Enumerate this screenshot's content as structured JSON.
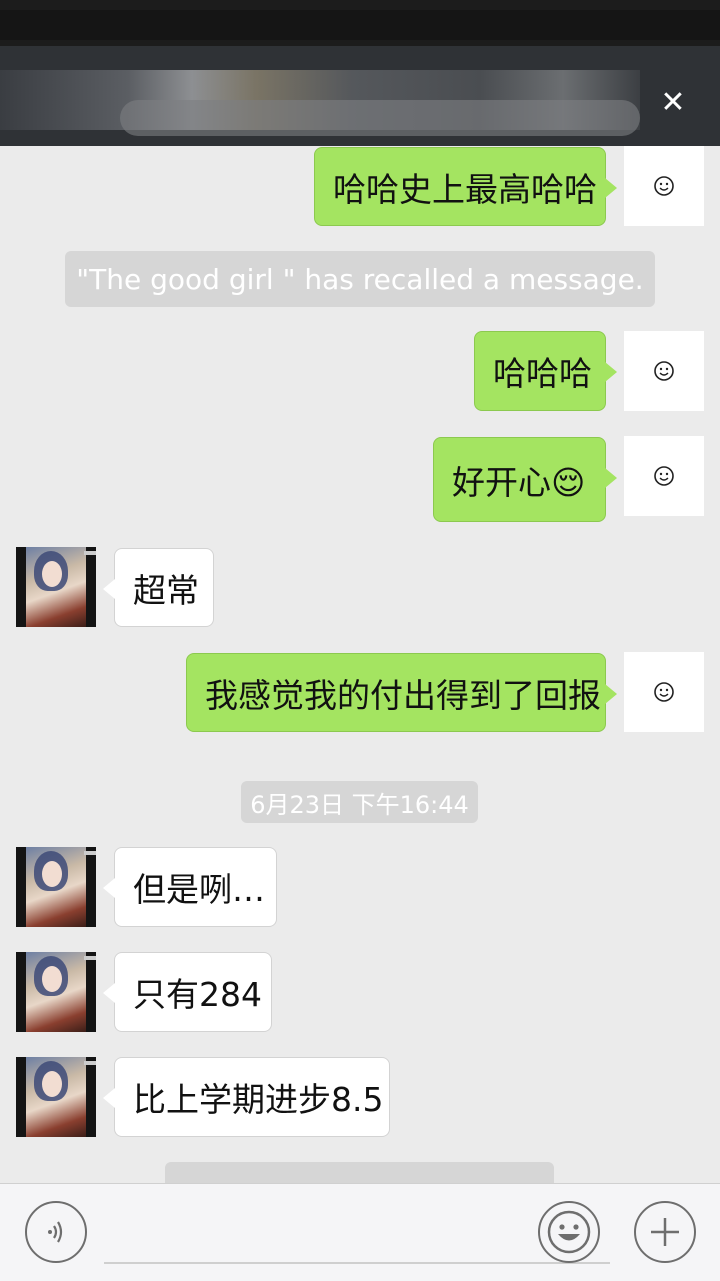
{
  "header": {
    "title": "",
    "close_icon": "close-x-icon",
    "color": "#2f3236"
  },
  "messages": {
    "m1": {
      "text": "哈哈史上最高哈哈"
    },
    "recall": {
      "text": "\"The good girl    \" has recalled a message."
    },
    "m2": {
      "text": "哈哈哈"
    },
    "m3": {
      "text": "好开心😌"
    },
    "m4": {
      "text": "超常"
    },
    "m5": {
      "text": "我感觉我的付出得到了回报"
    },
    "timestamp": {
      "text": "6月23日 下午16:44"
    },
    "m6": {
      "text": "但是咧…"
    },
    "m7": {
      "text": "只有284"
    },
    "m8": {
      "text": "比上学期进步8.5"
    }
  },
  "input_bar": {
    "voice_icon": "voice-icon",
    "emoji_icon": "emoji-icon",
    "plus_icon": "plus-icon",
    "text_value": ""
  },
  "colors": {
    "outgoing_bubble": "#a4e461",
    "incoming_bubble": "#ffffff",
    "background": "#ebebeb"
  }
}
